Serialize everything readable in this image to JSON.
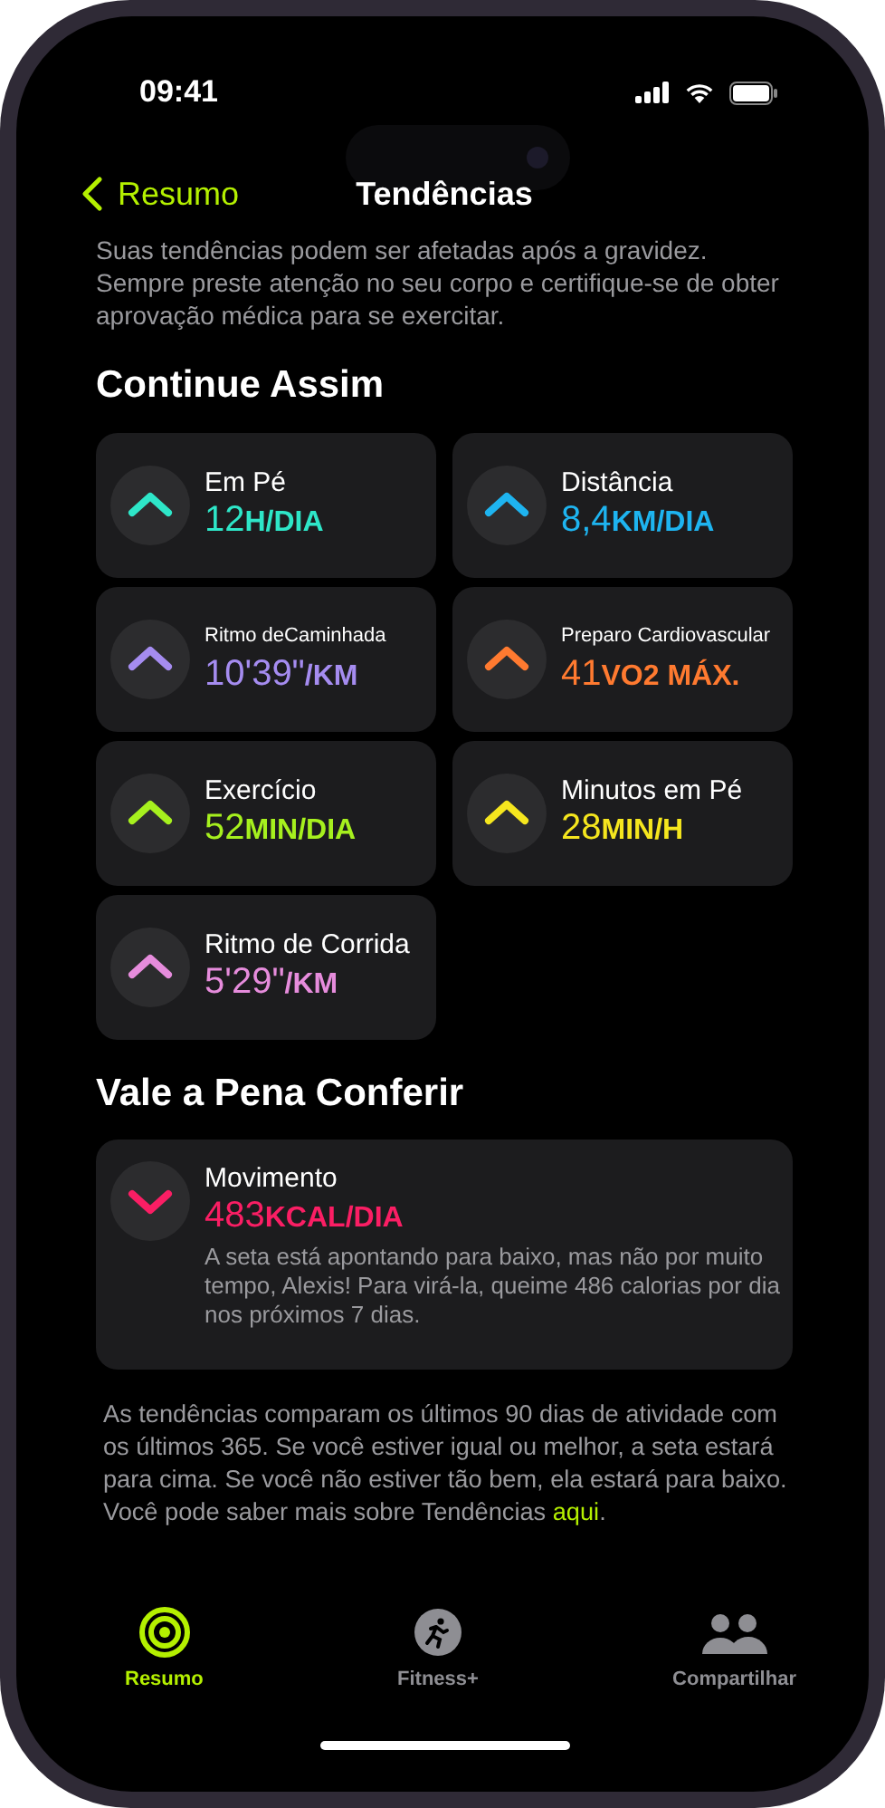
{
  "status_bar": {
    "time": "09:41"
  },
  "nav": {
    "back": "Resumo",
    "title": "Tendências"
  },
  "notice": "Suas tendências podem ser afetadas após a gravidez. Sempre preste atenção no seu corpo e certifique-se de obter aprovação médica para se exercitar.",
  "sections": [
    {
      "title": "Continue Assim",
      "kind": "grid",
      "trends": [
        {
          "name": "Em Pé",
          "value": "12",
          "unit": "H/DIA",
          "kind": "up",
          "color": "#2ee6c8"
        },
        {
          "name": "Distância",
          "value": "8,4",
          "unit": "KM/DIA",
          "kind": "up",
          "color": "#1eb4f0"
        },
        {
          "name": "Ritmo deCaminhada",
          "value": "10'39\"",
          "unit": "/KM",
          "kind": "up",
          "color": "#a58cf0",
          "small": true
        },
        {
          "name": "Preparo Cardiovascular",
          "value": "41",
          "unit": "VO2 MÁX.",
          "kind": "up",
          "color": "#ff7a30",
          "small": true
        },
        {
          "name": "Exercício",
          "value": "52",
          "unit": "MIN/DIA",
          "kind": "up",
          "color": "#a6f01e"
        },
        {
          "name": "Minutos em Pé",
          "value": "28",
          "unit": "MIN/H",
          "kind": "up",
          "color": "#f5e61e"
        },
        {
          "name": "Ritmo de Corrida",
          "value": "5'29\"",
          "unit": "/KM",
          "kind": "up",
          "color": "#e68cdc"
        }
      ]
    },
    {
      "title": "Vale a Pena Conferir",
      "kind": "wide",
      "trends": [
        {
          "name": "Movimento",
          "value": "483",
          "unit": "KCAL/DIA",
          "kind": "down",
          "color": "#fa1e64",
          "note": "A seta está apontando para baixo, mas não por muito tempo, Alexis! Para virá-la, queime 486 calorias por dia nos próximos 7 dias."
        }
      ]
    }
  ],
  "footer": {
    "text": "As tendências comparam os últimos 90 dias de atividade com os últimos 365. Se você estiver igual ou melhor, a seta estará para cima. Se você não estiver tão bem, ela estará para baixo. Você pode saber mais sobre Tendências",
    "link": "aqui",
    "after": "."
  },
  "tabs": [
    {
      "label": "Resumo",
      "kind": "rings",
      "selected": true
    },
    {
      "label": "Fitness+",
      "kind": "fitness",
      "selected": false
    },
    {
      "label": "Compartilhar",
      "kind": "sharing",
      "selected": false
    }
  ]
}
